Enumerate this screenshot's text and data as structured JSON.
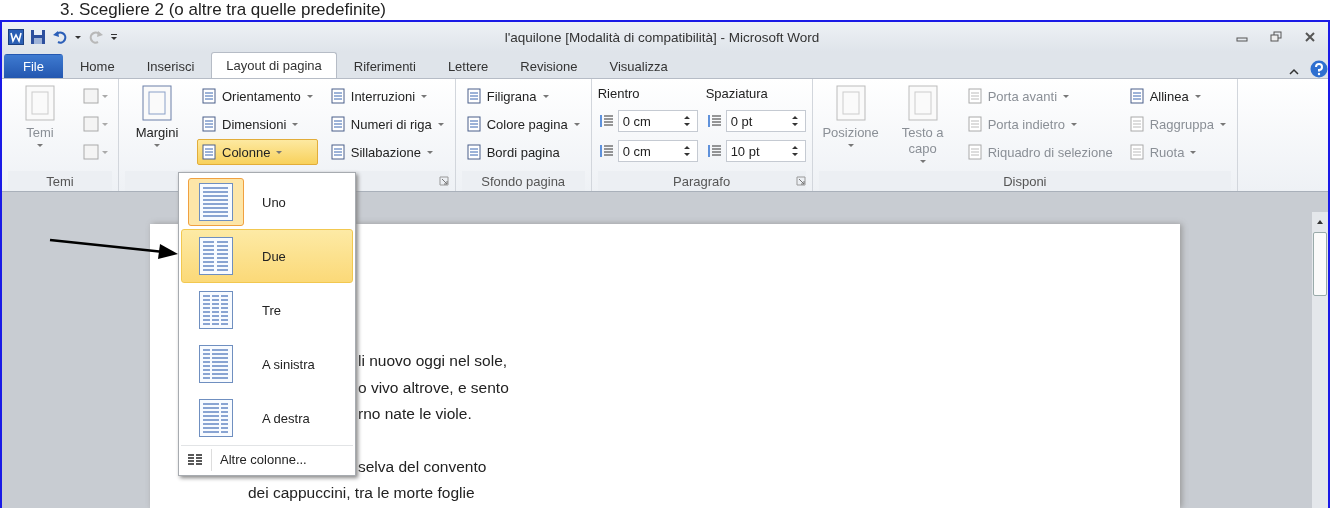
{
  "caption": "3. Scegliere 2 (o altre tra quelle predefinite)",
  "window": {
    "title": "l'aquilone [Modalità di compatibilità] - Microsoft Word"
  },
  "tabs": [
    {
      "label": "File",
      "kind": "file",
      "selected": false
    },
    {
      "label": "Home",
      "kind": "tab",
      "selected": false
    },
    {
      "label": "Inserisci",
      "kind": "tab",
      "selected": false
    },
    {
      "label": "Layout di pagina",
      "kind": "tab",
      "selected": true
    },
    {
      "label": "Riferimenti",
      "kind": "tab",
      "selected": false
    },
    {
      "label": "Lettere",
      "kind": "tab",
      "selected": false
    },
    {
      "label": "Revisione",
      "kind": "tab",
      "selected": false
    },
    {
      "label": "Visualizza",
      "kind": "tab",
      "selected": false
    }
  ],
  "ribbon": {
    "groups": [
      {
        "label": "Temi",
        "launcher": false,
        "columns": [
          {
            "items": [
              {
                "kind": "large",
                "label": "Temi",
                "dropdown": true,
                "disabled": true
              }
            ]
          },
          {
            "items": [
              {
                "kind": "iconbtn",
                "dropdown": true,
                "disabled": true
              },
              {
                "kind": "iconbtn",
                "dropdown": true,
                "disabled": true
              },
              {
                "kind": "iconbtn",
                "dropdown": true,
                "disabled": true
              }
            ]
          }
        ]
      },
      {
        "launcher": true,
        "columns": [
          {
            "items": [
              {
                "kind": "large",
                "label": "Margini",
                "dropdown": true,
                "disabled": false
              }
            ]
          },
          {
            "items": [
              {
                "kind": "small",
                "label": "Orientamento",
                "dropdown": true,
                "disabled": false,
                "active": false
              },
              {
                "kind": "small",
                "label": "Dimensioni",
                "dropdown": true,
                "disabled": false,
                "active": false
              },
              {
                "kind": "small",
                "label": "Colonne",
                "dropdown": true,
                "disabled": false,
                "active": true
              }
            ]
          },
          {
            "items": [
              {
                "kind": "small",
                "label": "Interruzioni",
                "dropdown": true,
                "disabled": false,
                "active": false
              },
              {
                "kind": "small",
                "label": "Numeri di riga",
                "dropdown": true,
                "disabled": false,
                "active": false
              },
              {
                "kind": "small",
                "label": "Sillabazione",
                "dropdown": true,
                "disabled": false,
                "active": false
              }
            ]
          }
        ]
      },
      {
        "label": "Sfondo pagina",
        "launcher": false,
        "columns": [
          {
            "items": [
              {
                "kind": "small",
                "label": "Filigrana",
                "dropdown": true,
                "disabled": false,
                "active": false
              },
              {
                "kind": "small",
                "label": "Colore pagina",
                "dropdown": true,
                "disabled": false,
                "active": false
              },
              {
                "kind": "small",
                "label": "Bordi pagina",
                "dropdown": false,
                "disabled": false,
                "active": false
              }
            ]
          }
        ]
      },
      {
        "label": "Paragrafo",
        "launcher": true,
        "columns": [
          {
            "items": [
              {
                "kind": "heading",
                "label": "Rientro"
              },
              {
                "kind": "spin",
                "value": "0 cm"
              },
              {
                "kind": "spin",
                "value": "0 cm"
              }
            ]
          },
          {
            "items": [
              {
                "kind": "heading",
                "label": "Spaziatura"
              },
              {
                "kind": "spin",
                "value": "0 pt"
              },
              {
                "kind": "spin",
                "value": "10 pt"
              }
            ]
          }
        ]
      },
      {
        "label": "Disponi",
        "launcher": false,
        "columns": [
          {
            "items": [
              {
                "kind": "large",
                "label": "Posizione",
                "dropdown": true,
                "disabled": true
              }
            ]
          },
          {
            "items": [
              {
                "kind": "large",
                "label": "Testo a capo",
                "dropdown": true,
                "disabled": true
              }
            ]
          },
          {
            "items": [
              {
                "kind": "small",
                "label": "Porta avanti",
                "dropdown": true,
                "disabled": true,
                "active": false
              },
              {
                "kind": "small",
                "label": "Porta indietro",
                "dropdown": true,
                "disabled": true,
                "active": false
              },
              {
                "kind": "small",
                "label": "Riquadro di selezione",
                "dropdown": false,
                "disabled": true,
                "active": false
              }
            ]
          },
          {
            "items": [
              {
                "kind": "small",
                "label": "Allinea",
                "dropdown": true,
                "disabled": false,
                "active": false
              },
              {
                "kind": "small",
                "label": "Raggruppa",
                "dropdown": true,
                "disabled": true,
                "active": false
              },
              {
                "kind": "small",
                "label": "Ruota",
                "dropdown": true,
                "disabled": true,
                "active": false
              }
            ]
          }
        ]
      }
    ]
  },
  "document": {
    "lines": [
      {
        "text": "li nuovo oggi nel sole,",
        "covered": true,
        "gap": false
      },
      {
        "text": "o vivo altrove, e sento",
        "covered": true,
        "gap": false
      },
      {
        "text": "rno nate le viole.",
        "covered": true,
        "gap": false
      },
      {
        "text": "selva del convento",
        "covered": true,
        "gap": true
      },
      {
        "text": "dei cappuccini, tra le morte foglie",
        "covered": false,
        "gap": false
      }
    ]
  },
  "columns_menu": {
    "items": [
      {
        "label": "Uno",
        "kind": "one",
        "selected": true,
        "hovered": false
      },
      {
        "label": "Due",
        "kind": "two",
        "selected": false,
        "hovered": true
      },
      {
        "label": "Tre",
        "kind": "three",
        "selected": false,
        "hovered": false
      },
      {
        "label": "A sinistra",
        "kind": "left",
        "selected": false,
        "hovered": false
      },
      {
        "label": "A destra",
        "kind": "right",
        "selected": false,
        "hovered": false
      }
    ],
    "more": "Altre colonne..."
  }
}
